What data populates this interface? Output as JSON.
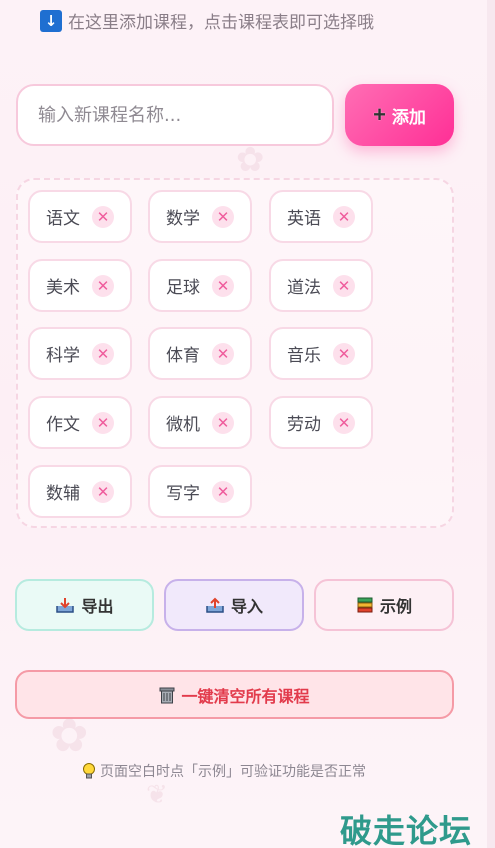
{
  "top_hint": {
    "icon": "down-arrow-icon",
    "text": "在这里添加课程，点击课程表即可选择哦"
  },
  "add_form": {
    "placeholder": "输入新课程名称...",
    "add_label": "添加",
    "add_icon": "plus-icon"
  },
  "courses": [
    "语文",
    "数学",
    "英语",
    "美术",
    "足球",
    "道法",
    "科学",
    "体育",
    "音乐",
    "作文",
    "微机",
    "劳动",
    "数辅",
    "写字"
  ],
  "remove_glyph": "✕",
  "actions": {
    "export_label": "导出",
    "import_label": "导入",
    "example_label": "示例"
  },
  "clear": {
    "label": "一键清空所有课程",
    "icon": "trash-icon"
  },
  "tip": {
    "icon": "lightbulb-icon",
    "text": "页面空白时点「示例」可验证功能是否正常"
  },
  "watermark": "破走论坛",
  "colors": {
    "accent": "#ff2f96",
    "export": "#b6ebdf",
    "import": "#c7b1ea",
    "example": "#f5c3d6",
    "danger": "#e23b4c",
    "watermark": "#2f9a8c"
  }
}
